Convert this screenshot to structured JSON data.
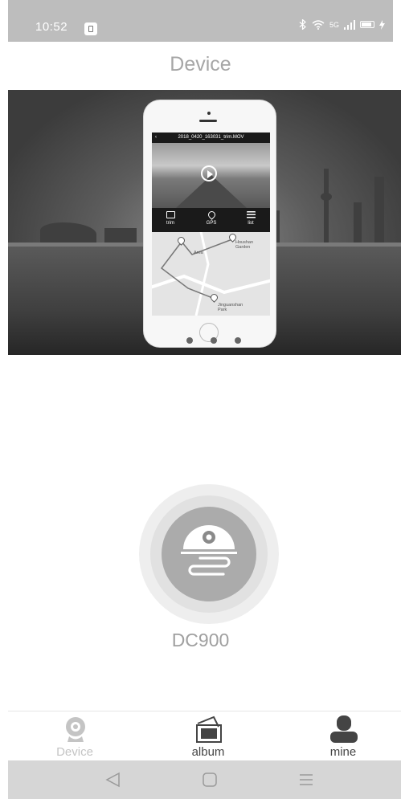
{
  "status_bar": {
    "time": "10:52",
    "network_label": "5G"
  },
  "header": {
    "title": "Device"
  },
  "banner": {
    "video_filename": "2018_0420_163031_trim.MOV",
    "toolbar": [
      "trim",
      "GPS",
      "list"
    ],
    "map_labels": {
      "area": "Area",
      "garden": "Houshan Garden",
      "park": "Jinguanshan Park"
    },
    "page_indicator_count": 3
  },
  "device": {
    "name": "DC900"
  },
  "tab_bar": {
    "items": [
      {
        "label": "Device",
        "icon": "webcam-icon",
        "active": true
      },
      {
        "label": "album",
        "icon": "photo-stack-icon",
        "active": false
      },
      {
        "label": "mine",
        "icon": "person-icon",
        "active": false
      }
    ]
  },
  "navigation_bar": {
    "buttons": [
      "back-icon",
      "home-icon",
      "recents-icon"
    ]
  },
  "colors": {
    "status_bar_bg": "#bdbdbd",
    "active_tab": "#c4c4c4",
    "inactive_tab": "#444444",
    "device_core": "#ababab"
  }
}
